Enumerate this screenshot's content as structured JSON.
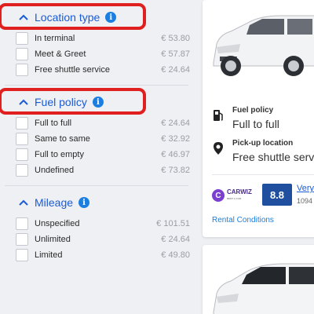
{
  "filters": {
    "location_type": {
      "title": "Location type",
      "info_icon": "info-icon",
      "options": [
        {
          "label": "In terminal",
          "price": "€ 53.80"
        },
        {
          "label": "Meet & Greet",
          "price": "€ 57.87"
        },
        {
          "label": "Free shuttle service",
          "price": "€ 24.64"
        }
      ]
    },
    "fuel_policy": {
      "title": "Fuel policy",
      "info_icon": "info-icon",
      "options": [
        {
          "label": "Full to full",
          "price": "€ 24.64"
        },
        {
          "label": "Same to same",
          "price": "€ 32.92"
        },
        {
          "label": "Full to empty",
          "price": "€ 46.97"
        },
        {
          "label": "Undefined",
          "price": "€ 73.82"
        }
      ]
    },
    "mileage": {
      "title": "Mileage",
      "info_icon": "info-icon",
      "options": [
        {
          "label": "Unspecified",
          "price": "€ 101.51"
        },
        {
          "label": "Unlimited",
          "price": "€ 24.64"
        },
        {
          "label": "Limited",
          "price": "€ 49.80"
        }
      ]
    }
  },
  "result_card": {
    "fuel_policy_label": "Fuel policy",
    "fuel_policy_value": "Full to full",
    "pickup_label": "Pick-up location",
    "pickup_value": "Free shuttle servic",
    "supplier": {
      "logo_text": "CARWIZ",
      "logo_subtext": "RENT A CAR"
    },
    "rating_score": "8.8",
    "rating_label": "Very",
    "rating_count": "1094",
    "rental_conditions_link": "Rental Conditions"
  },
  "colors": {
    "accent_blue": "#1a5bd6",
    "highlight_red": "#e0201e",
    "score_blue": "#1f4f9e"
  }
}
